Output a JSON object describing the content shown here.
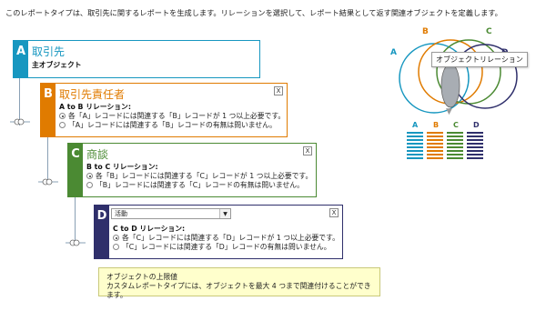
{
  "intro": "このレポートタイプは、取引先に関するレポートを生成します。リレーションを選択して、レポート結果として返す関連オブジェクトを定義します。",
  "colors": {
    "a": "#1797c0",
    "b": "#e07b00",
    "c": "#4b8a33",
    "d": "#2f2f6b"
  },
  "objects": {
    "a": {
      "letter": "A",
      "title": "取引先",
      "subtitle": "主オブジェクト"
    },
    "b": {
      "letter": "B",
      "title": "取引先責任者",
      "relation_label": "A to B リレーション:",
      "option1": "各「A」レコードには関連する「B」レコードが 1 つ以上必要です。",
      "option2": "「A」レコードには関連する「B」レコードの有無は問いません。",
      "close": "X"
    },
    "c": {
      "letter": "C",
      "title": "商談",
      "relation_label": "B to C リレーション:",
      "option1": "各「B」レコードには関連する「C」レコードが 1 つ以上必要です。",
      "option2": "「B」レコードには関連する「C」レコードの有無は問いません。",
      "close": "X"
    },
    "d": {
      "letter": "D",
      "select_value": "活動",
      "select_arrow": "▼",
      "relation_label": "C to D リレーション:",
      "option1": "各「C」レコードには関連する「D」レコードが 1 つ以上必要です。",
      "option2": "「C」レコードには関連する「D」レコードの有無は問いません。",
      "close": "X"
    }
  },
  "note": {
    "title": "オブジェクトの上限値",
    "text": "カスタムレポートタイプには、オブジェクトを最大 4 つまで関連付けることができます。"
  },
  "diagram": {
    "labels": [
      "A",
      "B",
      "C",
      "D"
    ],
    "tooltip": "オブジェクトリレーション",
    "arrow": "▼",
    "table_headers": [
      "A",
      "B",
      "C",
      "D"
    ]
  }
}
